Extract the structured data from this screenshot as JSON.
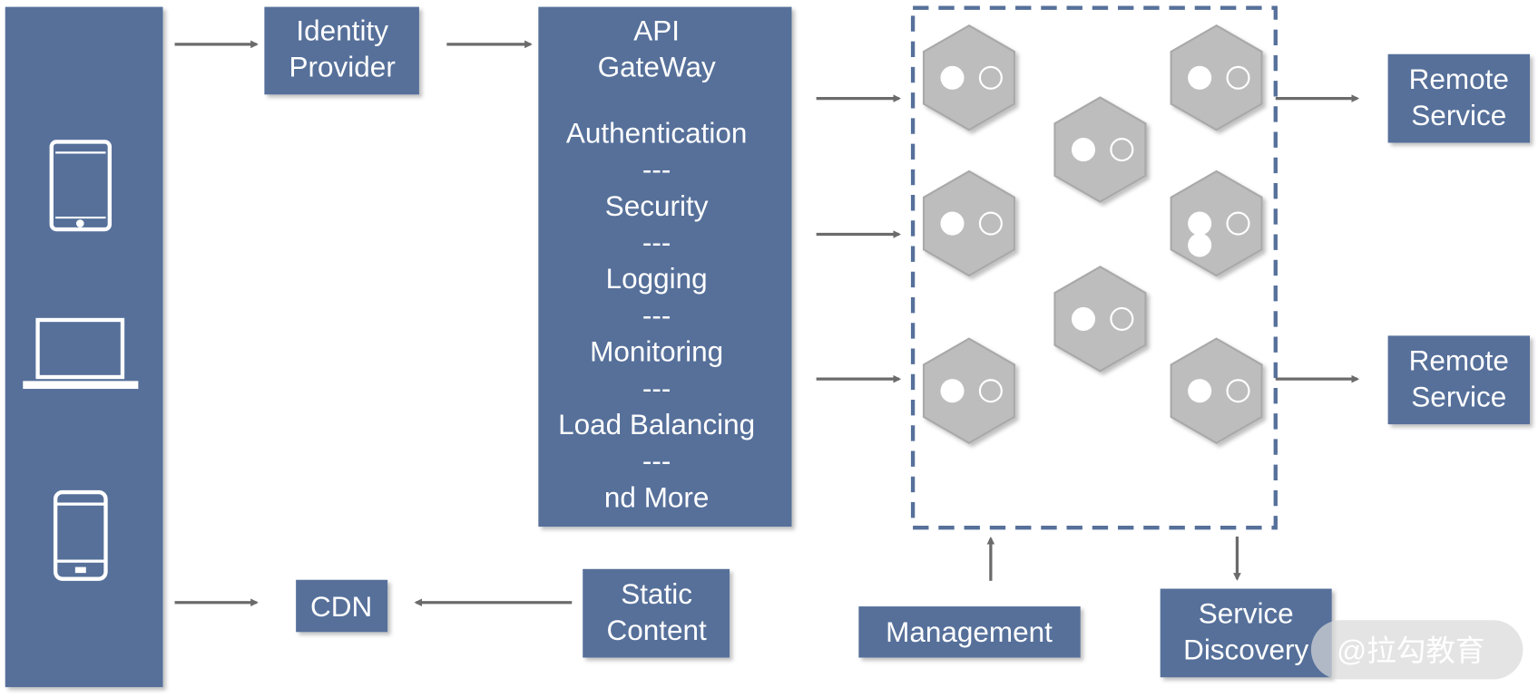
{
  "colors": {
    "box": "#56709a",
    "hexagon": "#bdbdbd",
    "arrow": "#6b6b6b",
    "text": "#ffffff"
  },
  "clients": {
    "icons": [
      "tablet-icon",
      "laptop-icon",
      "phone-icon"
    ]
  },
  "identity_provider": [
    "Identity",
    "Provider"
  ],
  "api_gateway": {
    "title": [
      "API",
      "GateWay"
    ],
    "features": [
      "Authentication",
      "---",
      "Security",
      "---",
      "Logging",
      "---",
      "Monitoring",
      "---",
      "Load Balancing",
      "---",
      "nd More"
    ]
  },
  "remote_services": [
    [
      "Remote",
      "Service"
    ],
    [
      "Remote",
      "Service"
    ]
  ],
  "cdn": "CDN",
  "static_content": [
    "Static",
    "Content"
  ],
  "management": "Management",
  "service_discovery": [
    "Service",
    "Discovery"
  ],
  "watermark": "@拉勾教育"
}
